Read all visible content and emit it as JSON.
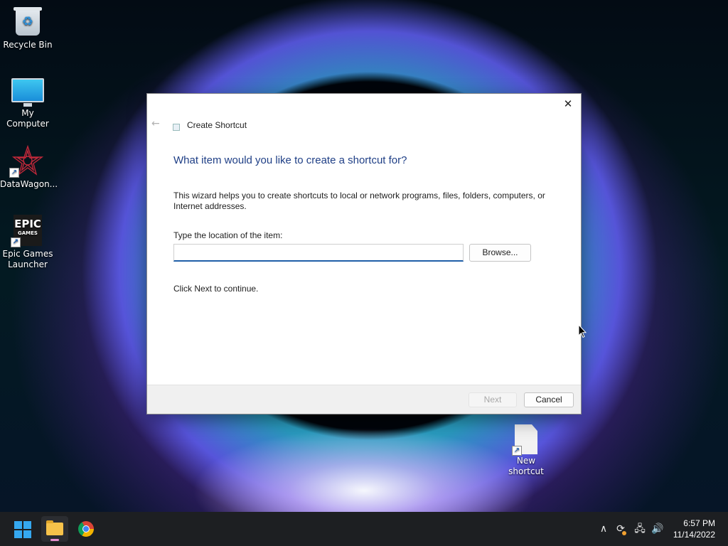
{
  "desktop": {
    "icons": [
      {
        "label": "Recycle Bin"
      },
      {
        "label": "My Computer"
      },
      {
        "label": "DataWagon..."
      },
      {
        "label": "Epic Games Launcher",
        "logo_line1": "EPIC",
        "logo_line2": "GAMES"
      },
      {
        "label": "New shortcut"
      }
    ]
  },
  "dialog": {
    "title": "Create Shortcut",
    "close_glyph": "✕",
    "back_glyph": "←",
    "heading": "What item would you like to create a shortcut for?",
    "description": "This wizard helps you to create shortcuts to local or network programs, files, folders, computers, or Internet addresses.",
    "location_label": "Type the location of the item:",
    "location_value": "",
    "browse_label": "Browse...",
    "continue_text": "Click Next to continue.",
    "next_label": "Next",
    "cancel_label": "Cancel"
  },
  "taskbar": {
    "apps": [
      "start",
      "file-explorer",
      "chrome"
    ],
    "tray": {
      "chevron_glyph": "∧",
      "update_glyph": "⟳",
      "network_glyph": "🖧",
      "volume_glyph": "🔊"
    },
    "time": "6:57 PM",
    "date": "11/14/2022"
  },
  "colors": {
    "heading": "#1f3f86",
    "accent": "#1f5fa8",
    "windows_blue": "#35a8f0",
    "taskbar_bg": "#1d1f22"
  }
}
